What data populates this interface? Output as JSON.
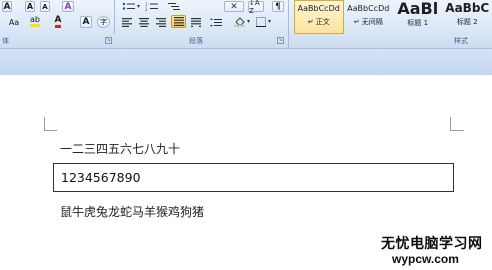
{
  "ribbon": {
    "row1": {
      "grow_font_a": "A",
      "shrink_font_a": "A",
      "clear_format_a": "A",
      "list_bullets_icon": "bullet-list-icon",
      "list_numbers_icon": "numbered-list-icon",
      "multilevel_icon": "multilevel-list-icon",
      "decrease_indent_icon": "decrease-indent-icon",
      "increase_indent_icon": "increase-indent-icon",
      "sort_label": "↓A Z",
      "show_marks_label": "¶"
    },
    "row2": {
      "change_case_label": "Aa",
      "highlight_label": "ab",
      "font_color_label": "A",
      "char_shading_label": "A",
      "enclose_char_label": "字",
      "align_left_icon": "align-left-icon",
      "center_icon": "align-center-icon",
      "align_right_icon": "align-right-icon",
      "justify_icon": "justify-icon",
      "distributed_icon": "distributed-icon",
      "line_spacing_icon": "line-spacing-icon",
      "shading_icon": "shading-icon",
      "borders_icon": "borders-icon"
    },
    "groups": {
      "font_label": "体",
      "paragraph_label": "段落",
      "styles_label": "样式"
    },
    "styles": [
      {
        "sample": "AaBbCcDd",
        "name": "↵ 正文",
        "selected": true
      },
      {
        "sample": "AaBbCcDd",
        "name": "↵ 无间隔",
        "selected": false
      },
      {
        "sample": "AaBl",
        "name": "标题 1",
        "selected": false
      },
      {
        "sample": "AaBbC",
        "name": "标题 2",
        "selected": false
      }
    ],
    "colors": {
      "highlight": "#f4e700",
      "font_color": "#e02020"
    }
  },
  "document": {
    "line1": "一二三四五六七八九十",
    "line2_boxed": "1234567890",
    "line3": "鼠牛虎兔龙蛇马羊猴鸡狗猪"
  },
  "watermark": {
    "line1": "无忧电脑学习网",
    "line2": "wypcw.com"
  }
}
